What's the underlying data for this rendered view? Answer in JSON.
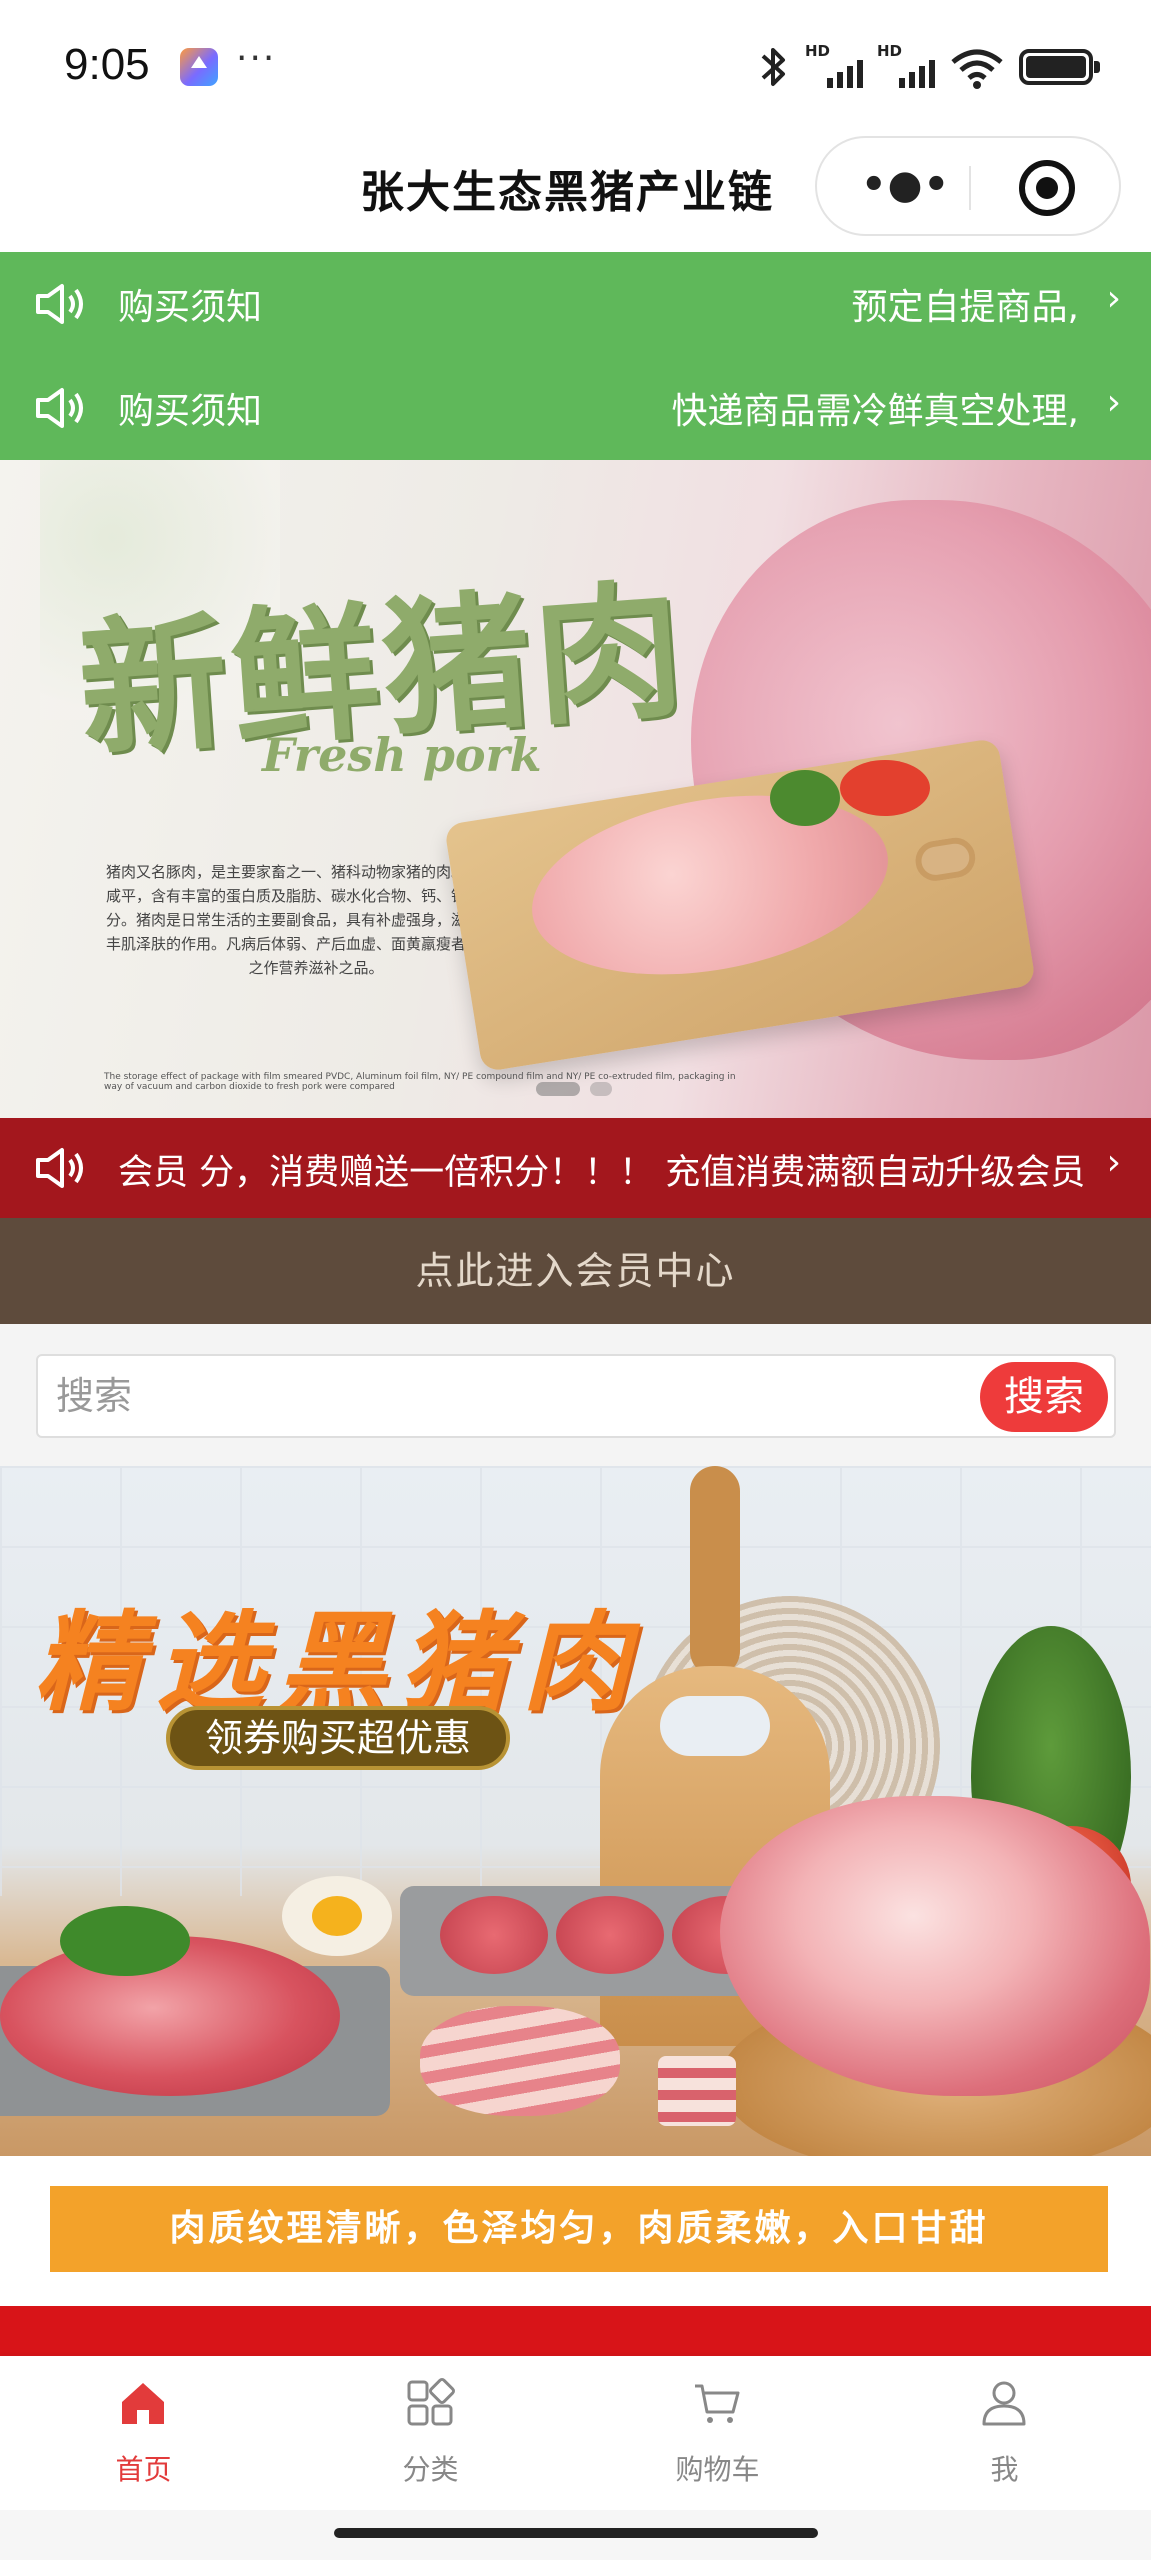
{
  "status_bar": {
    "time": "9:05",
    "dots": "···",
    "hd1": "HD",
    "hd2": "HD"
  },
  "title_bar": {
    "title": "张大生态黑猪产业链",
    "more": "•●•"
  },
  "notices": [
    {
      "label": "购买须知",
      "text": "预定自提商品,",
      "chevron": "›"
    },
    {
      "label": "购买须知",
      "text": "快递商品需冷鲜真空处理,",
      "chevron": "›"
    }
  ],
  "banner_1": {
    "headline": "新鲜猪肉",
    "subtitle": "Fresh pork",
    "description": "猪肉又名豚肉，是主要家畜之一、猪科动物家猪的肉。其性味甘咸平，含有丰富的蛋白质及脂肪、碳水化合物、钙、铁、磷等成分。猪肉是日常生活的主要副食品，具有补虚强身，滋阴润燥、丰肌泽肤的作用。凡病后体弱、产后血虚、面黄羸瘦者，皆可用之作营养滋补之品。",
    "fineprint": "The storage effect of package with film smeared PVDC, Aluminum foil film, NY/ PE compound film and NY/ PE co-extruded film, packaging in way of vacuum and carbon dioxide to fresh pork were compared"
  },
  "member_notice": {
    "text": "会员 分，消费赠送一倍积分！！！ 充值消费满额自动升级会员",
    "chevron": "›"
  },
  "member_center": {
    "label": "点此进入会员中心"
  },
  "search": {
    "placeholder": "搜索",
    "button_label": "搜索"
  },
  "banner_2": {
    "headline": "精选黑猪肉",
    "pill": "领券购买超优惠"
  },
  "tagline": {
    "text": "肉质纹理清晰，色泽均匀，肉质柔嫩，入口甘甜"
  },
  "tab_bar": {
    "items": [
      {
        "label": "首页",
        "icon": "home-icon",
        "active": true
      },
      {
        "label": "分类",
        "icon": "category-icon",
        "active": false
      },
      {
        "label": "购物车",
        "icon": "cart-icon",
        "active": false
      },
      {
        "label": "我",
        "icon": "user-icon",
        "active": false
      }
    ]
  },
  "colors": {
    "notice_green": "#5fb85a",
    "member_red": "#a3171d",
    "member_center_brown": "#5e4b3c",
    "search_button_red": "#ee3b3b",
    "accent_orange": "#f58220",
    "tab_active": "#e23b3b"
  }
}
